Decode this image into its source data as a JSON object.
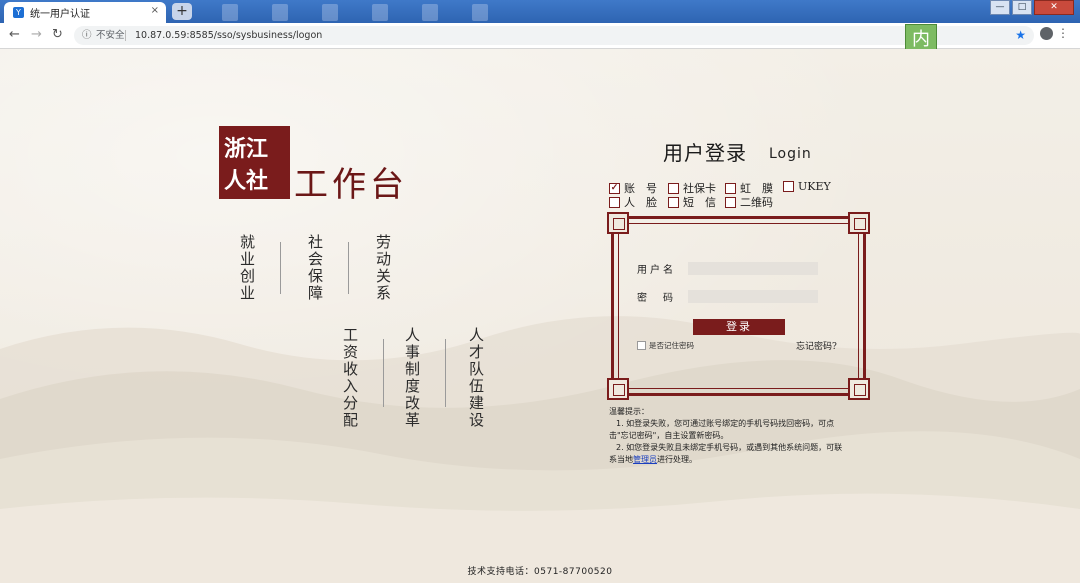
{
  "browser": {
    "tab_title": "统一用户认证",
    "tab_close": "×",
    "new_tab": "+",
    "favicon": "Y",
    "security_label": "不安全",
    "url": "10.87.0.59:8585/sso/sysbusiness/logon",
    "badge": "内",
    "window_controls": {
      "minimize": "—",
      "maximize": "□",
      "close": "✕"
    }
  },
  "logo": {
    "seal_line1": "浙江",
    "seal_line2": "人社",
    "rest": "工作台"
  },
  "nav": {
    "row1": [
      "就业创业",
      "社会保障",
      "劳动关系"
    ],
    "row2": [
      "工资收入分配",
      "人事制度改革",
      "人才队伍建设"
    ]
  },
  "login": {
    "title": "用户登录",
    "title_en": "Login",
    "modes": [
      {
        "label": "账　号",
        "checked": true
      },
      {
        "label": "社保卡",
        "checked": false
      },
      {
        "label": "虹　膜",
        "checked": false
      },
      {
        "label": "UKEY",
        "checked": false
      },
      {
        "label": "人　脸",
        "checked": false
      },
      {
        "label": "短　信",
        "checked": false
      },
      {
        "label": "二维码",
        "checked": false
      }
    ],
    "username_label": "用户名",
    "username_value": "",
    "password_label": "密　码",
    "password_value": "",
    "submit_label": "登录",
    "remember_label": "是否记住密码",
    "forgot_label": "忘记密码?"
  },
  "tips": {
    "heading": "温馨提示：",
    "line1a": "1. 如登录失败，您可通过账号绑定的手机号码找回密码，可点",
    "line1b": "击\"忘记密码\"，自主设置新密码。",
    "line2a": "2. 如您登录失败且未绑定手机号码，或遇到其他系统问题，可联",
    "line2b_pre": "系当地",
    "line2b_link": "管理员",
    "line2b_post": "进行处理。"
  },
  "footer": {
    "support": "技术支持电话：0571-87700520"
  }
}
